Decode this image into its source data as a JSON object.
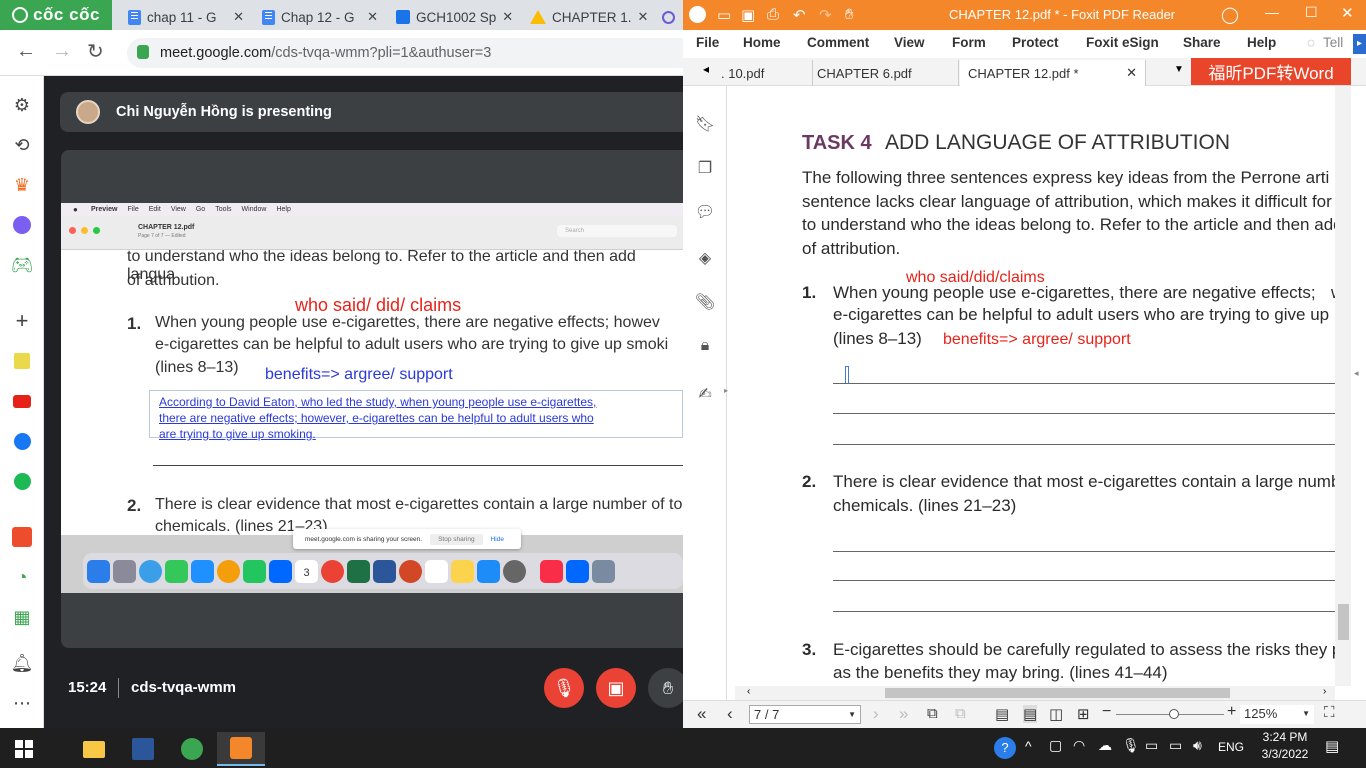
{
  "browser": {
    "brand": "cốc cốc",
    "tabs": [
      {
        "label": "chap 11 - G"
      },
      {
        "label": "Chap 12 - G"
      },
      {
        "label": "GCH1002 Sp"
      },
      {
        "label": "CHAPTER 1."
      }
    ],
    "url_host": "meet.google.com",
    "url_path": "/cds-tvqa-wmm?pli=1&authuser=3"
  },
  "meet": {
    "presenter_text": "Chi Nguyễn Hồng is presenting",
    "time": "15:24",
    "meeting_code": "cds-tvqa-wmm"
  },
  "shared_screen": {
    "menu": [
      "Preview",
      "File",
      "Edit",
      "View",
      "Go",
      "Tools",
      "Window",
      "Help"
    ],
    "doc_title": "CHAPTER 12.pdf",
    "doc_sub": "Page 7 of 7 — Edited",
    "search_placeholder": "Search",
    "line_top": "to understand who the ideas belong to. Refer to the article and then add langua",
    "line_attr": "of attribution.",
    "annotation_red": "who said/ did/ claims",
    "item1_num": "1.",
    "item1_l1": "When young people use e-cigarettes, there are negative effects; howev",
    "item1_l2": "e-cigarettes can be helpful to adult users who are trying to give up smoki",
    "item1_l3": "(lines 8–13)",
    "annotation_blue": "benefits=> argree/ support",
    "answer_l1": "According to David Eaton, who led the study, when young people use e-cigarettes,",
    "answer_l2": "there are negative effects; however, e-cigarettes can be helpful to adult users who",
    "answer_l3": "are trying to give up smoking.",
    "item2_num": "2.",
    "item2_l1": "There is clear evidence that most e-cigarettes contain a large number of to",
    "item2_l2": "chemicals. (lines 21–23)",
    "sharing_text": "meet.google.com is sharing your screen.",
    "stop_label": "Stop sharing",
    "hide_label": "Hide",
    "dock_date": "3"
  },
  "foxit": {
    "window_title": "CHAPTER 12.pdf * - Foxit PDF Reader",
    "menu": [
      "File",
      "Home",
      "Comment",
      "View",
      "Form",
      "Protect",
      "Foxit eSign",
      "Share",
      "Help",
      "Tell"
    ],
    "doc_tabs": [
      ". 10.pdf",
      "CHAPTER 6.pdf",
      "CHAPTER 12.pdf *"
    ],
    "promo": "福昕PDF转Word",
    "page_indicator": "7 / 7",
    "zoom": "125%"
  },
  "pdf": {
    "task_label": "TASK 4",
    "task_title": "ADD LANGUAGE OF ATTRIBUTION",
    "intro_l1": "The following three sentences express key ideas from the Perrone arti",
    "intro_l2": "sentence lacks clear language of attribution, which makes it difficult for t",
    "intro_l3": "to understand who the ideas belong to. Refer to the article and then add",
    "intro_l4": "of attribution.",
    "annotation_red": "who said/did/claims",
    "item1_num": "1.",
    "item1_l1": "When young people use e-cigarettes, there are negative effects;",
    "item1_l1b": "w",
    "item1_l2": "e-cigarettes can be helpful to adult users who are trying to give up",
    "item1_l3": "(lines 8–13)",
    "annotation_benefits": "benefits=> argree/ support",
    "item2_num": "2.",
    "item2_l1": "There is clear evidence that most e-cigarettes contain a large numbe",
    "item2_l2": "chemicals. (lines 21–23)",
    "item3_num": "3.",
    "item3_l1": "E-cigarettes should be carefully regulated to assess the risks they po",
    "item3_l2": "as the benefits they may bring. (lines 41–44)"
  },
  "taskbar": {
    "time": "3:24 PM",
    "date": "3/3/2022",
    "lang": "ENG"
  },
  "colors": {
    "coccoc_green": "#3aa651",
    "foxit_orange": "#f5872b",
    "promo_red": "#e8452a",
    "annotation_red": "#e8231a",
    "annotation_blue": "#2b39d8",
    "task_purple": "#6b3a62",
    "end_call_red": "#ea4335"
  }
}
